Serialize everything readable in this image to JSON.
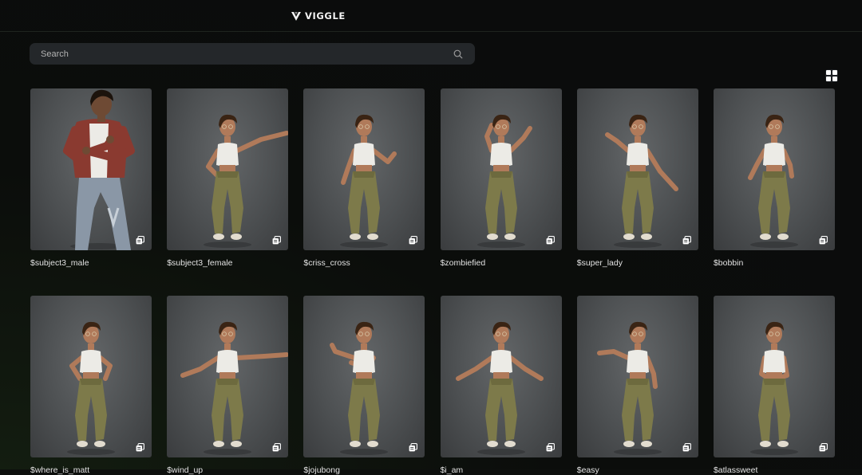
{
  "brand": {
    "name": "VIGGLE",
    "icon": "viggle-logo-icon"
  },
  "search": {
    "placeholder": "Search",
    "value": "",
    "icon": "search-icon"
  },
  "view_toggle": {
    "icon": "grid-view-icon"
  },
  "templates": [
    {
      "label": "$subject3_male",
      "character": "male",
      "pose": "arms-crossed"
    },
    {
      "label": "$subject3_female",
      "character": "female",
      "pose": "arm-up-right"
    },
    {
      "label": "$criss_cross",
      "character": "female",
      "pose": "arms-bent"
    },
    {
      "label": "$zombiefied",
      "character": "female",
      "pose": "zombie"
    },
    {
      "label": "$super_lady",
      "character": "female",
      "pose": "arms-out-low"
    },
    {
      "label": "$bobbin",
      "character": "female",
      "pose": "arms-down"
    },
    {
      "label": "$where_is_matt",
      "character": "female",
      "pose": "arms-bent-up"
    },
    {
      "label": "$wind_up",
      "character": "female",
      "pose": "arms-wide"
    },
    {
      "label": "$jojubong",
      "character": "female",
      "pose": "arms-cross-chest"
    },
    {
      "label": "$i_am",
      "character": "female",
      "pose": "arms-spread"
    },
    {
      "label": "$easy",
      "character": "female",
      "pose": "arm-point-left"
    },
    {
      "label": "$atlassweet",
      "character": "female",
      "pose": "arms-in"
    }
  ],
  "colors": {
    "background": "#0b0d0b",
    "search_bg": "#24272a",
    "thumb_bg": "#4d5052",
    "skin": "#b07a5a",
    "top_white": "#ecebe6",
    "pants_olive": "#7d7a4a",
    "hair": "#3a2414",
    "shoes": "#e2dccf",
    "male_shirt": "#8a3a30",
    "male_jeans": "#8a97a6"
  }
}
